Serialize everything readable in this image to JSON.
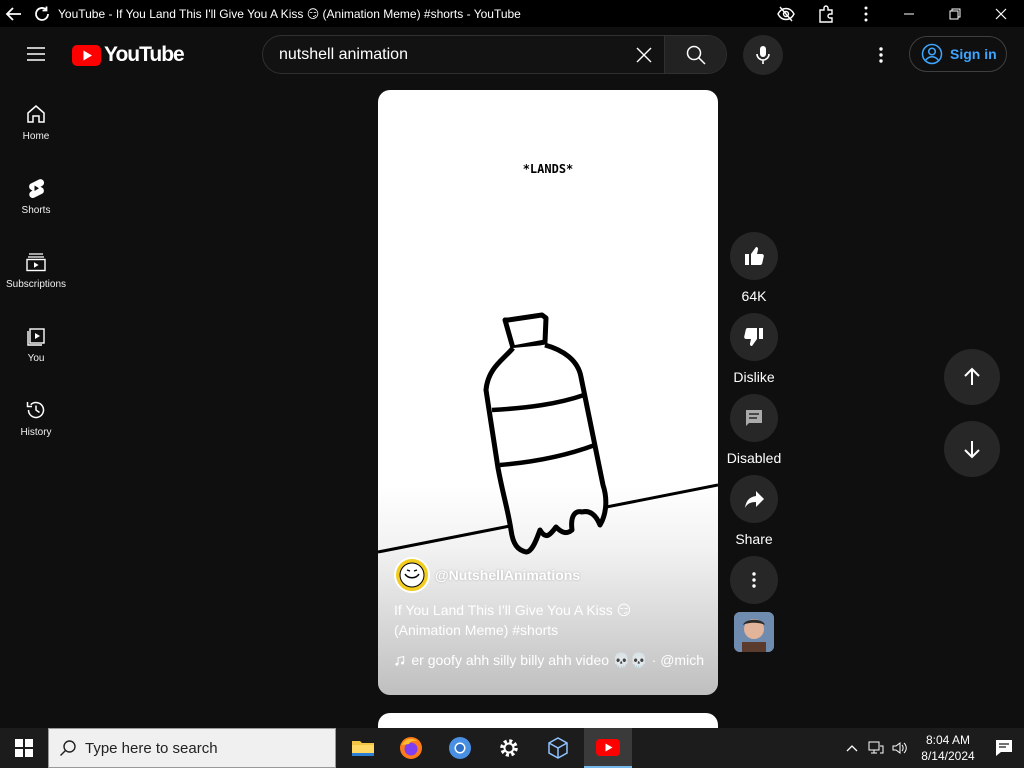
{
  "window": {
    "title": "YouTube - If You Land This I'll Give You A Kiss 😏 (Animation Meme) #shorts - YouTube"
  },
  "header": {
    "logo_text": "YouTube",
    "search_value": "nutshell animation",
    "signin_label": "Sign in"
  },
  "sidebar": {
    "items": [
      {
        "label": "Home",
        "icon": "home-icon"
      },
      {
        "label": "Shorts",
        "icon": "shorts-icon"
      },
      {
        "label": "Subscriptions",
        "icon": "subscriptions-icon"
      },
      {
        "label": "You",
        "icon": "you-icon"
      },
      {
        "label": "History",
        "icon": "history-icon"
      }
    ]
  },
  "short": {
    "caption": "*LANDS*",
    "channel": "@NutshellAnimations",
    "title": "If You Land This I'll Give You A Kiss 😏 (Animation Meme) #shorts",
    "music": "er goofy ahh silly billy ahh video 💀💀 · @mich"
  },
  "actions": {
    "like_count": "64K",
    "dislike_label": "Dislike",
    "comments_label": "Disabled",
    "share_label": "Share"
  },
  "taskbar": {
    "search_placeholder": "Type here to search",
    "time": "8:04 AM",
    "date": "8/14/2024"
  },
  "colors": {
    "background": "#0f0f0f",
    "brand_red": "#ff0000",
    "link_blue": "#3ea6ff",
    "button_gray": "#272727"
  }
}
